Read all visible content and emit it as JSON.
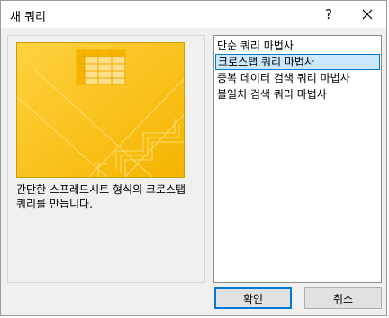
{
  "window": {
    "title": "새 쿼리"
  },
  "titlebar": {
    "help_label": "?"
  },
  "preview": {
    "description": "간단한 스프레드시트 형식의 크로스탭 쿼리를 만듭니다.",
    "colors": {
      "background": "#fcc419",
      "table": "#ffe08a"
    }
  },
  "wizard_list": {
    "items": [
      {
        "label": "단순 쿼리 마법사",
        "selected": false
      },
      {
        "label": "크로스탭 쿼리 마법사",
        "selected": true
      },
      {
        "label": "중복 데이터 검색 쿼리 마법사",
        "selected": false
      },
      {
        "label": "불일치 검색 쿼리 마법사",
        "selected": false
      }
    ],
    "selection_color": "#cce8ff",
    "selection_border": "#0078d7"
  },
  "buttons": {
    "ok_label": "확인",
    "cancel_label": "취소"
  }
}
